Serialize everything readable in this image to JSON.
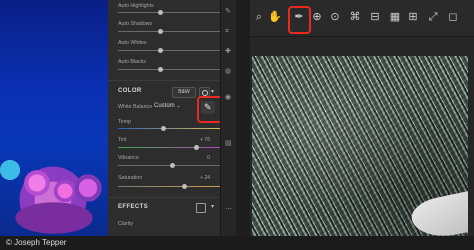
{
  "panel": {
    "auto_rows": [
      "Auto Highlights",
      "Auto Shadows",
      "Auto Whites",
      "Auto Blacks"
    ],
    "color_section": {
      "title": "COLOR",
      "bw_label": "B&W",
      "white_balance_label": "White Balance",
      "white_balance_value": "Custom",
      "sliders": [
        {
          "label": "Temp",
          "value": ""
        },
        {
          "label": "Tint",
          "value": "+ 76"
        },
        {
          "label": "Vibrance",
          "value": "0"
        },
        {
          "label": "Saturation",
          "value": "+ 24"
        }
      ]
    },
    "effects_section": {
      "title": "EFFECTS",
      "first_row": "Clarity"
    }
  },
  "credit": "© Joseph Tepper",
  "colors": {
    "highlight": "#e62b1e",
    "panel_bg": "#2d2d2d"
  },
  "icons": [
    "search-icon",
    "hand-icon",
    "eyedropper-icon",
    "target-adjust-icon",
    "redeye-icon",
    "crop-icon",
    "straighten-icon",
    "grid-icon",
    "grid-overlay-icon",
    "expand-icon"
  ]
}
